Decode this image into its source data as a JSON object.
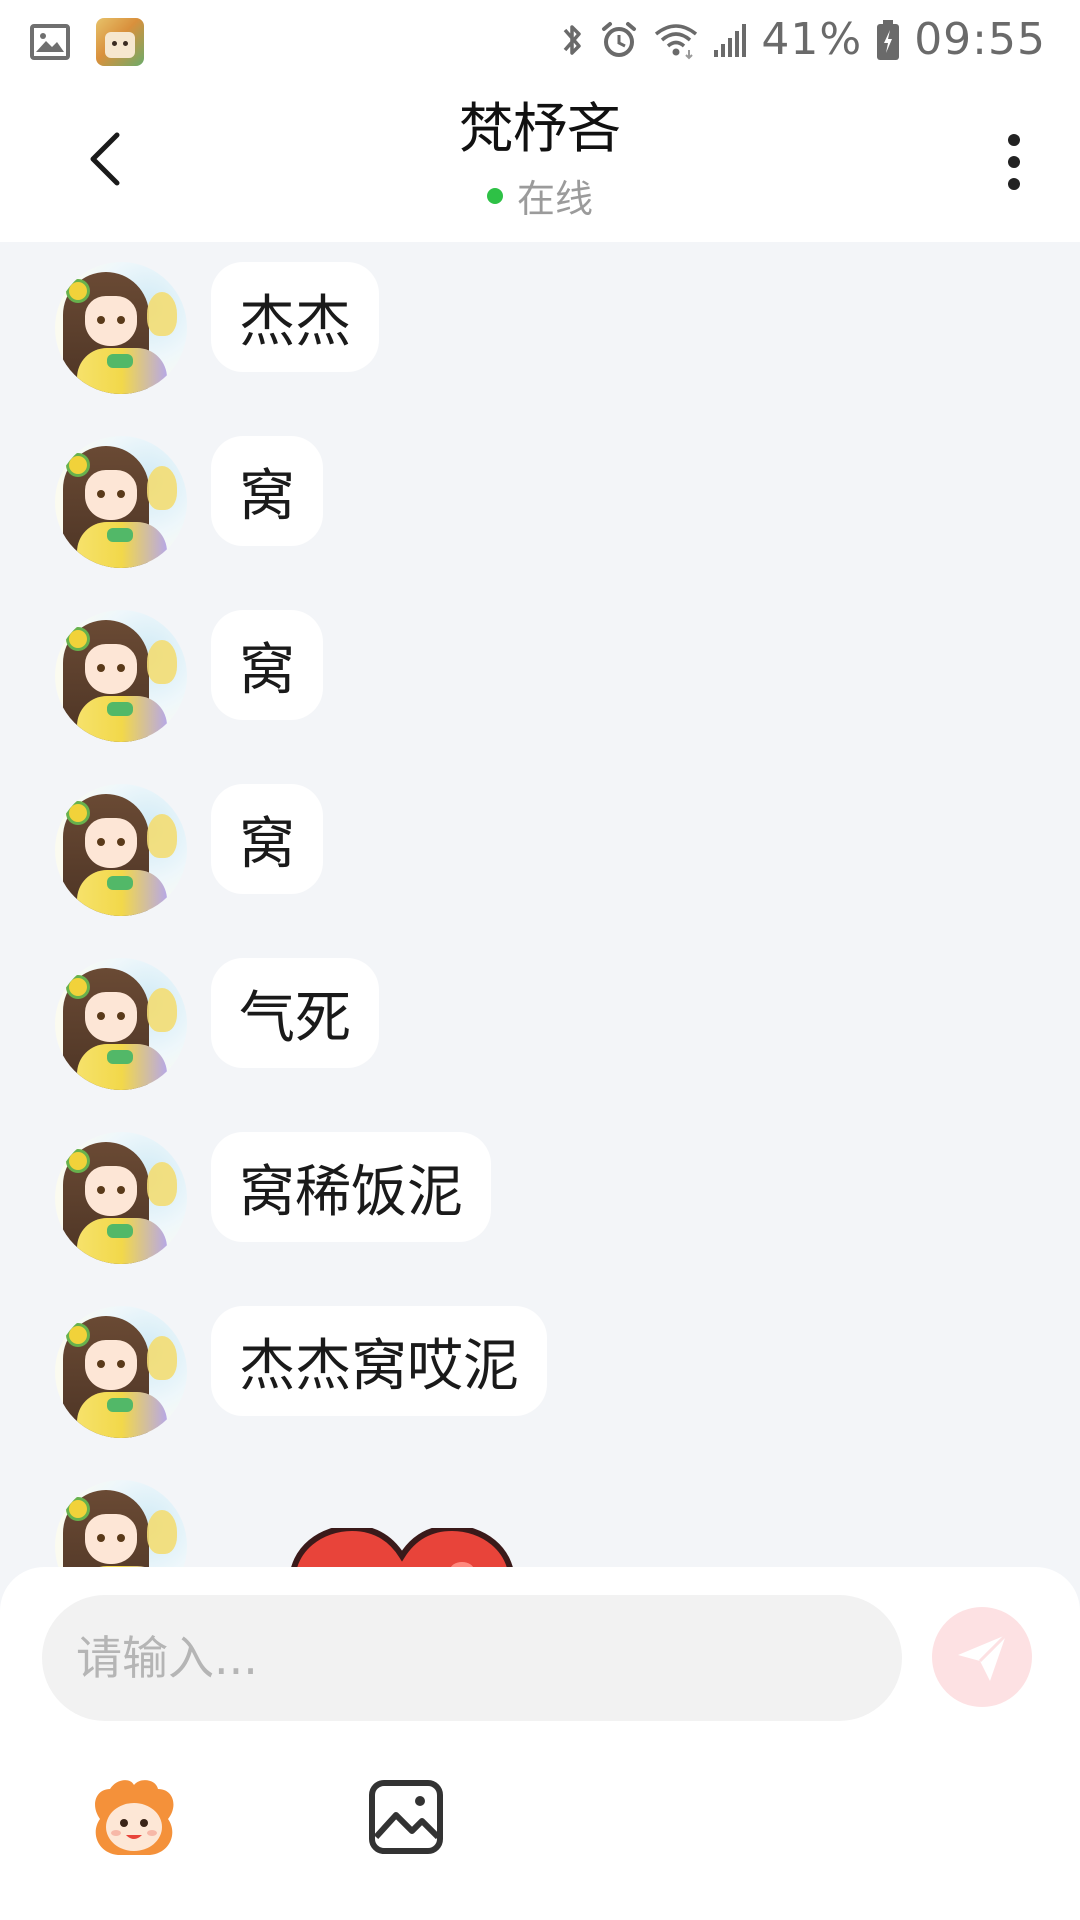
{
  "status_bar": {
    "battery": "41%",
    "time": "09:55",
    "icons": [
      "gallery-icon",
      "app-icon",
      "bluetooth-icon",
      "alarm-icon",
      "wifi-icon",
      "signal-icon",
      "battery-icon"
    ]
  },
  "header": {
    "title": "梵杼吝",
    "status": "在线",
    "status_color": "#2ec146",
    "back_icon": "chevron-left-icon",
    "more_icon": "more-vertical-icon"
  },
  "messages": [
    {
      "text": "杰杰"
    },
    {
      "text": "窝"
    },
    {
      "text": "窝"
    },
    {
      "text": "窝"
    },
    {
      "text": "气死"
    },
    {
      "text": "窝稀饭泥"
    },
    {
      "text": "杰杰窝哎泥"
    }
  ],
  "sticker": {
    "type": "heart",
    "color": "#e8443a"
  },
  "composer": {
    "placeholder": "请输入...",
    "send_icon": "send-icon",
    "send_color": "#fde1e3",
    "tools": [
      "emoji-mascot-icon",
      "image-icon"
    ]
  }
}
